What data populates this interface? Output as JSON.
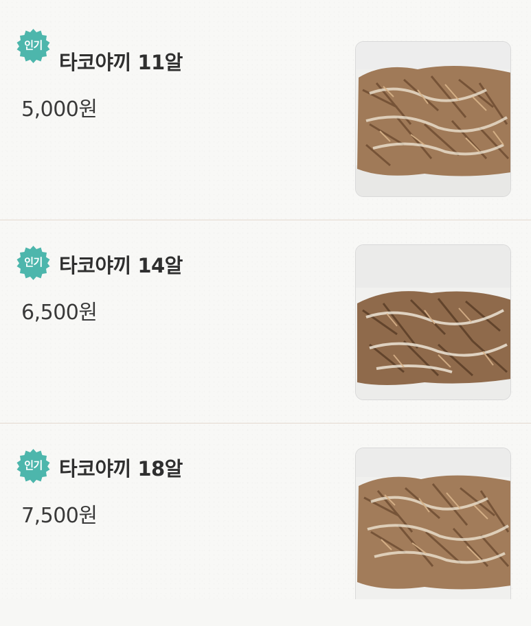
{
  "menu": {
    "items": [
      {
        "badge": "인기",
        "name": "타코야끼 11알",
        "price": "5,000원",
        "photo_icon": "takoyaki-photo"
      },
      {
        "badge": "인기",
        "name": "타코야끼 14알",
        "price": "6,500원",
        "photo_icon": "takoyaki-photo"
      },
      {
        "badge": "인기",
        "name": "타코야끼 18알",
        "price": "7,500원",
        "photo_icon": "takoyaki-photo"
      }
    ]
  },
  "colors": {
    "badge": "#4db6ac",
    "divider": "#e4d9cf",
    "text_primary": "#2f2f2f",
    "background": "#f8f8f6"
  }
}
